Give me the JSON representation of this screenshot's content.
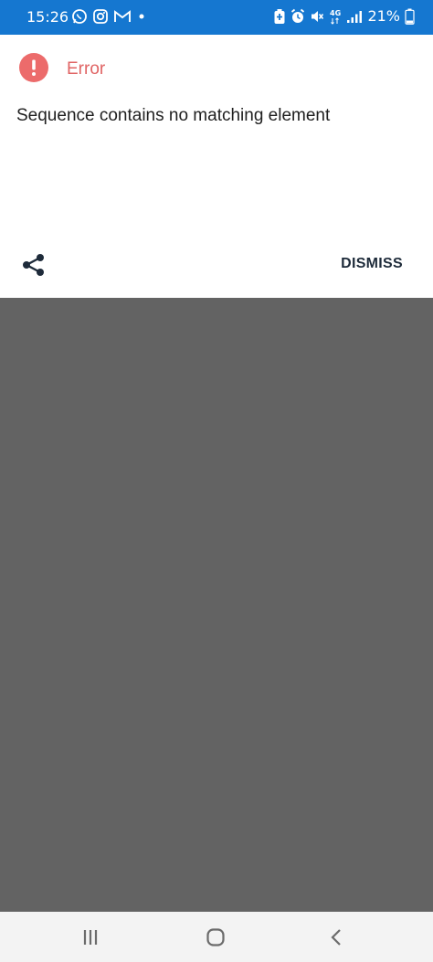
{
  "status_bar": {
    "time": "15:26",
    "left_icons": [
      "whatsapp-icon",
      "instagram-icon",
      "gmail-icon",
      "dot-icon"
    ],
    "right_icons": [
      "battery-saver-icon",
      "alarm-icon",
      "mute-icon",
      "network-4g-icon",
      "signal-icon"
    ],
    "network_label": "4G",
    "battery_text": "21%",
    "background_color": "#1577d0"
  },
  "dialog": {
    "title": "Error",
    "title_color": "#e06464",
    "icon": "error-exclamation-icon",
    "icon_color": "#ec6b6b",
    "message": "Sequence contains no matching element",
    "share_icon": "share-icon",
    "dismiss_label": "DISMISS"
  },
  "scrim_color": "#636363",
  "nav_bar": {
    "buttons": [
      "recent-apps-icon",
      "home-icon",
      "back-icon"
    ]
  }
}
